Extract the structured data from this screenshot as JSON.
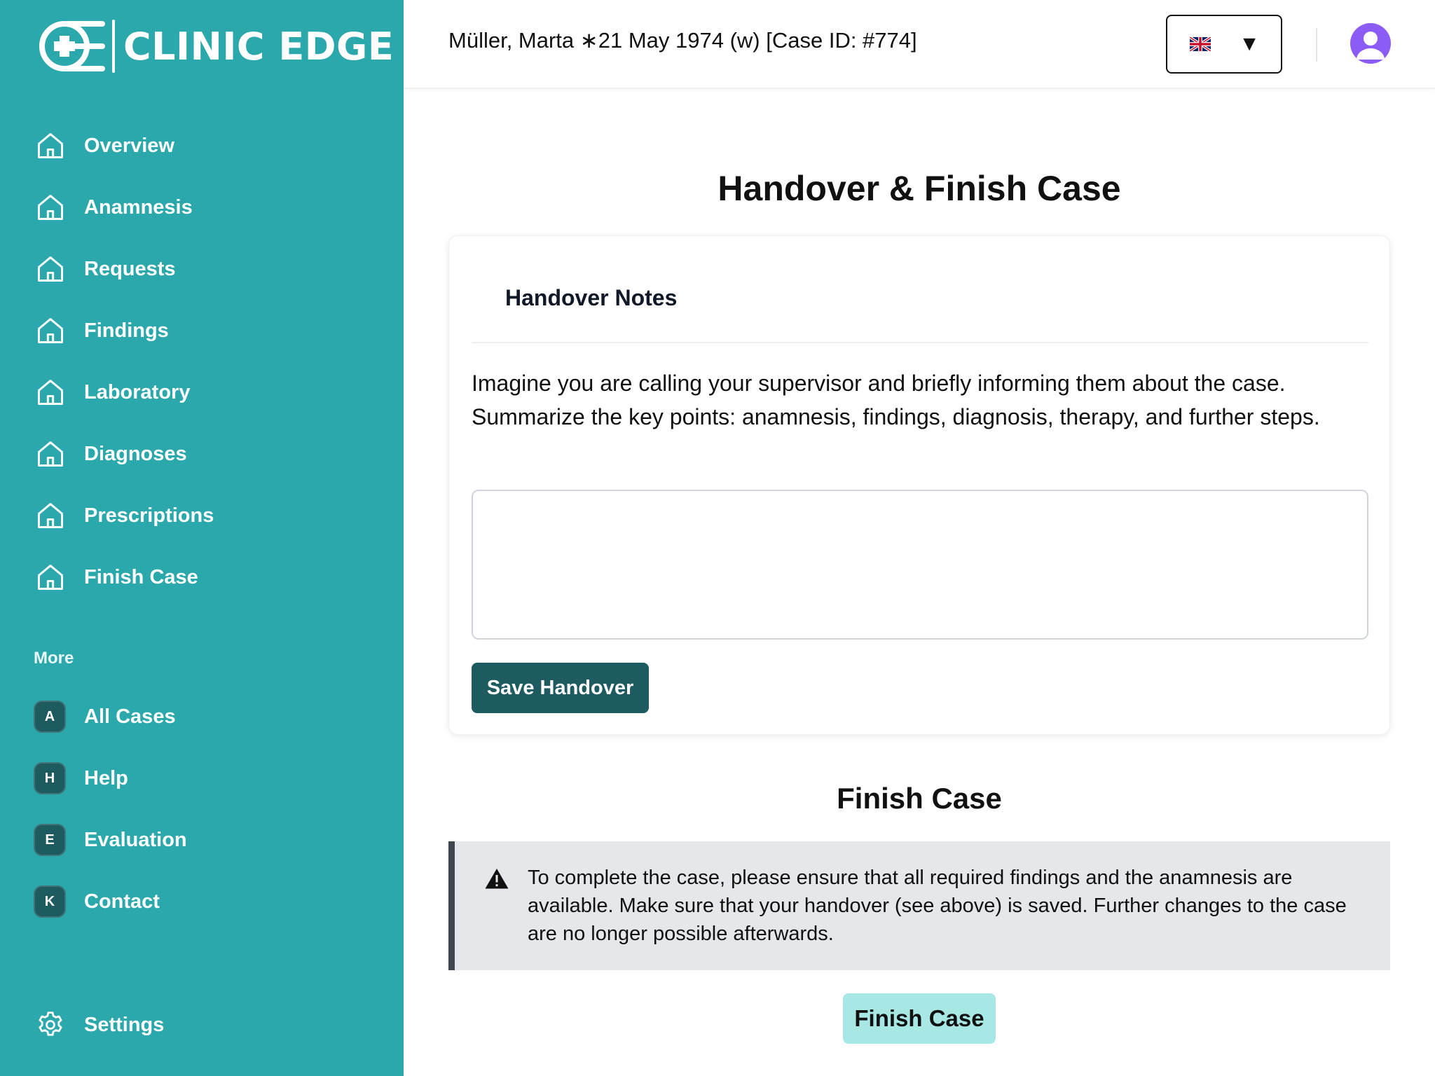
{
  "app": {
    "name": "CLINIC EDGE",
    "logo_icon": "clinic-edge-logo"
  },
  "colors": {
    "sidebar": "#2ba8ac",
    "primary_dark": "#1d5b61",
    "finish_button": "#a7e8e4",
    "avatar": "#8b5cf6",
    "alert_bg": "#e5e7eb"
  },
  "sidebar": {
    "items": [
      {
        "label": "Overview",
        "icon": "home-icon"
      },
      {
        "label": "Anamnesis",
        "icon": "home-icon"
      },
      {
        "label": "Requests",
        "icon": "home-icon"
      },
      {
        "label": "Findings",
        "icon": "home-icon"
      },
      {
        "label": "Laboratory",
        "icon": "home-icon"
      },
      {
        "label": "Diagnoses",
        "icon": "home-icon"
      },
      {
        "label": "Prescriptions",
        "icon": "home-icon"
      },
      {
        "label": "Finish Case",
        "icon": "home-icon"
      }
    ],
    "more_label": "More",
    "more_items": [
      {
        "badge": "A",
        "label": "All Cases"
      },
      {
        "badge": "H",
        "label": "Help"
      },
      {
        "badge": "E",
        "label": "Evaluation"
      },
      {
        "badge": "K",
        "label": "Contact"
      }
    ],
    "settings_label": "Settings",
    "settings_icon": "gear-icon"
  },
  "header": {
    "patient": "Müller, Marta ∗21 May 1974 (w) [Case ID: #774]",
    "language_flag": "uk-flag-icon",
    "language_caret": "▼",
    "avatar_icon": "user-avatar-icon"
  },
  "main": {
    "title": "Handover & Finish Case",
    "handover": {
      "title": "Handover Notes",
      "description": "Imagine you are calling your supervisor and briefly informing them about the case. Summarize the key points: anamnesis, findings, diagnosis, therapy, and further steps.",
      "notes_value": "",
      "save_label": "Save Handover"
    },
    "finish": {
      "title": "Finish Case",
      "alert_icon": "warning-icon",
      "alert_text": "To complete the case, please ensure that all required findings and the anamnesis are available. Make sure that your handover (see above) is saved. Further changes to the case are no longer possible afterwards.",
      "button_label": "Finish Case"
    }
  }
}
